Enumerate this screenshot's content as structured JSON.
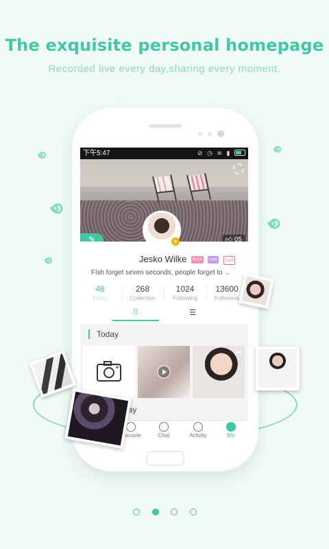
{
  "header": {
    "headline": "The exquisite personal homepage",
    "subline": "Recorded live every day,sharing every moment."
  },
  "colors": {
    "accent": "#3ec9a2",
    "background": "#f1faf7"
  },
  "status_bar": {
    "time": "下午5:47",
    "icons": [
      "mute-icon",
      "alarm-icon",
      "wifi-icon",
      "signal-icon",
      "battery-icon"
    ]
  },
  "profile": {
    "likes": "05",
    "username": "Jesko Wilke",
    "tags": [
      "9.14",
      "Leo",
      "Lv3"
    ],
    "verified_badge": "v",
    "bio": "Fish forget seven seconds, people forget to",
    "stats": [
      {
        "value": "48",
        "label": "Posts"
      },
      {
        "value": "268",
        "label": "Collection"
      },
      {
        "value": "1024",
        "label": "Following"
      },
      {
        "value": "13600",
        "label": "Followers"
      }
    ],
    "view_tabs": [
      "grid-icon",
      "list-icon"
    ]
  },
  "feed": {
    "today_label": "Today",
    "yesterday_label": "day"
  },
  "tab_bar": [
    {
      "label": "Discover",
      "icon": "compass-icon"
    },
    {
      "label": "Chat",
      "icon": "chat-icon"
    },
    {
      "label": "Activity",
      "icon": "heart-icon"
    },
    {
      "label": "Me",
      "icon": "person-icon"
    }
  ],
  "pagination": {
    "pages": 4,
    "current": 2
  }
}
